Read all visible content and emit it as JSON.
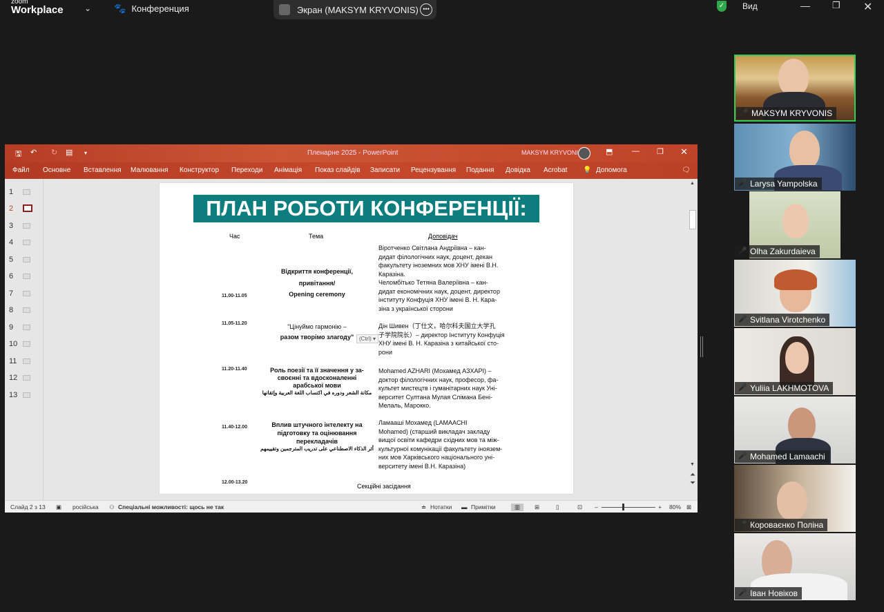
{
  "zoom": {
    "logo_top": "zoom",
    "logo_bottom": "Workplace",
    "meeting_title": "Конференция",
    "share_label": "Экран (MAKSYM KRYVONIS)",
    "view_label": "Вид"
  },
  "ppt": {
    "doc_title": "Пленарне 2025  -  PowerPoint",
    "user": "MAKSYM KRYVONIS",
    "tabs": [
      "Файл",
      "Основне",
      "Вставлення",
      "Малювання",
      "Конструктор",
      "Переходи",
      "Анімація",
      "Показ слайдів",
      "Записати",
      "Рецензування",
      "Подання",
      "Довідка",
      "Acrobat",
      "Допомога"
    ],
    "slide_numbers": [
      "1",
      "2",
      "3",
      "4",
      "5",
      "6",
      "7",
      "8",
      "9",
      "10",
      "11",
      "12",
      "13"
    ],
    "status": {
      "slide_info": "Слайд 2 з 13",
      "language": "російська",
      "accessibility": "Спеціальні можливості: щось не так",
      "notes": "Нотатки",
      "comments": "Примітки",
      "zoom": "80%"
    }
  },
  "slide": {
    "title": "ПЛАН РОБОТИ КОНФЕРЕНЦІЇ:",
    "headers": {
      "time": "Час",
      "topic": "Тема",
      "speaker": "Доповідач"
    },
    "rows": [
      {
        "time": "11.00-11.05",
        "topic_lines": [
          "Відкриття конференції,",
          "привітання/",
          "Opening ceremony"
        ],
        "speaker_lines": [
          "Віротченко Світлана Андріївна – кан-",
          "дидат філологічних наук, доцент, декан",
          "факультету іноземних мов ХНУ імені В.Н.",
          "Каразіна.",
          "Челомбітько Тетяна Валеріївна – кан-",
          "дидат економічних наук, доцент, директор",
          "інституту Конфуція ХНУ імені В. Н. Кара-",
          "зіна з української сторони"
        ]
      },
      {
        "time": "11.05-11.20",
        "topic_lines": [
          "\"Цінуймо гармонію –",
          "разом творімо злагоду\""
        ],
        "speaker_lines": [
          "Дін Шивен（丁仕文，哈尔科夫国立大学孔",
          "子学院院长）– директор Інституту Конфуція",
          "ХНУ імені В. Н. Каразіна з китайської сто-",
          "рони"
        ]
      },
      {
        "time": "11.20-11.40",
        "topic_lines": [
          "Роль поезії та її значення у за-",
          "своєнні та вдосконаленні",
          "арабської мови"
        ],
        "topic_arabic": "مكانة الشعر ودوره في اكتساب اللغة العربية وإتقانها",
        "speaker_lines": [
          "Mohamed AZHARI (Мохамед АЗХАРІ) –",
          "доктор філологічних наук, професор, фа-",
          "культет мистецтв і гуманітарних наук Уні-",
          "верситет Султана Мулая Слімана Бені-",
          "Мелаль, Марокко."
        ]
      },
      {
        "time": "11.40-12.00",
        "topic_lines": [
          "Вплив штучного інтелекту на",
          "підготовку та оцінювання",
          "перекладачів"
        ],
        "topic_arabic": "أثر الذكاء الاصطناعي على تدريب المترجمين وتقييمهم",
        "speaker_lines": [
          "Ламааші Мохамед (LAMAACHI",
          "Mohamed) (старший викладач закладу",
          "вищої освіти кафедри східних мов та між-",
          "культурної комунікації факультету іноязем-",
          "них мов Харківського національного уні-",
          "верситету імені В.Н. Каразіна)"
        ]
      },
      {
        "time": "12.00-13.20",
        "topic_lines": [
          "Секційні засідання"
        ],
        "speaker_lines": []
      }
    ],
    "paste_hint": "(Ctrl) ▾"
  },
  "participants": [
    {
      "name": "MAKSYM KRYVONIS"
    },
    {
      "name": "Larysa Yampolska"
    },
    {
      "name": "Olha Zakurdaieva"
    },
    {
      "name": "Svitlana Virotchenko"
    },
    {
      "name": "Yuliia LAKHMOTOVA"
    },
    {
      "name": "Mohamed Lamaachi"
    },
    {
      "name": "Коровaєнко Поліна"
    },
    {
      "name": "Іван Новіков"
    }
  ]
}
